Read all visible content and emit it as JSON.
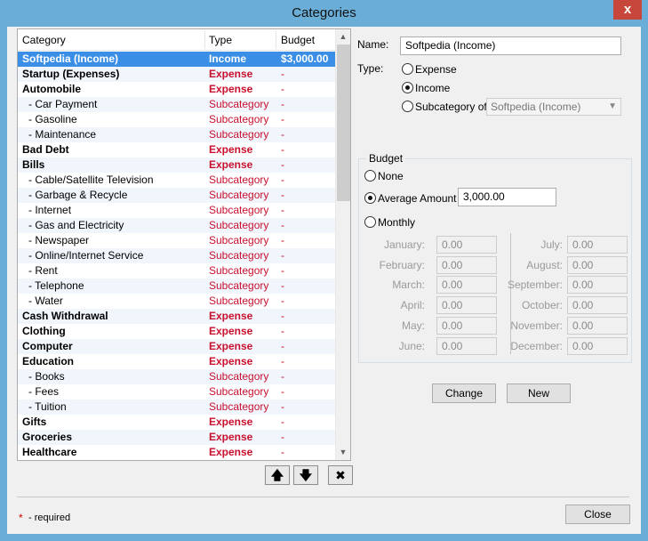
{
  "window": {
    "title": "Categories",
    "close_glyph": "x"
  },
  "list": {
    "headers": {
      "category": "Category",
      "type": "Type",
      "budget": "Budget"
    },
    "rows": [
      {
        "name": "Softpedia (Income)",
        "type": "Income",
        "budget": "$3,000.00",
        "level": 0,
        "kind": "inc",
        "selected": true
      },
      {
        "name": "Startup (Expenses)",
        "type": "Expense",
        "budget": "-",
        "level": 0,
        "kind": "exp"
      },
      {
        "name": "Automobile",
        "type": "Expense",
        "budget": "-",
        "level": 0,
        "kind": "exp"
      },
      {
        "name": "- Car Payment",
        "type": "Subcategory",
        "budget": "-",
        "level": 1,
        "kind": "sub"
      },
      {
        "name": "- Gasoline",
        "type": "Subcategory",
        "budget": "-",
        "level": 1,
        "kind": "sub"
      },
      {
        "name": "- Maintenance",
        "type": "Subcategory",
        "budget": "-",
        "level": 1,
        "kind": "sub"
      },
      {
        "name": "Bad Debt",
        "type": "Expense",
        "budget": "-",
        "level": 0,
        "kind": "exp"
      },
      {
        "name": "Bills",
        "type": "Expense",
        "budget": "-",
        "level": 0,
        "kind": "exp"
      },
      {
        "name": "- Cable/Satellite Television",
        "type": "Subcategory",
        "budget": "-",
        "level": 1,
        "kind": "sub"
      },
      {
        "name": "- Garbage & Recycle",
        "type": "Subcategory",
        "budget": "-",
        "level": 1,
        "kind": "sub"
      },
      {
        "name": "- Internet",
        "type": "Subcategory",
        "budget": "-",
        "level": 1,
        "kind": "sub"
      },
      {
        "name": "- Gas and Electricity",
        "type": "Subcategory",
        "budget": "-",
        "level": 1,
        "kind": "sub"
      },
      {
        "name": "- Newspaper",
        "type": "Subcategory",
        "budget": "-",
        "level": 1,
        "kind": "sub"
      },
      {
        "name": "- Online/Internet Service",
        "type": "Subcategory",
        "budget": "-",
        "level": 1,
        "kind": "sub"
      },
      {
        "name": "- Rent",
        "type": "Subcategory",
        "budget": "-",
        "level": 1,
        "kind": "sub"
      },
      {
        "name": "- Telephone",
        "type": "Subcategory",
        "budget": "-",
        "level": 1,
        "kind": "sub"
      },
      {
        "name": "- Water",
        "type": "Subcategory",
        "budget": "-",
        "level": 1,
        "kind": "sub"
      },
      {
        "name": "Cash Withdrawal",
        "type": "Expense",
        "budget": "-",
        "level": 0,
        "kind": "exp"
      },
      {
        "name": "Clothing",
        "type": "Expense",
        "budget": "-",
        "level": 0,
        "kind": "exp"
      },
      {
        "name": "Computer",
        "type": "Expense",
        "budget": "-",
        "level": 0,
        "kind": "exp"
      },
      {
        "name": "Education",
        "type": "Expense",
        "budget": "-",
        "level": 0,
        "kind": "exp"
      },
      {
        "name": "- Books",
        "type": "Subcategory",
        "budget": "-",
        "level": 1,
        "kind": "sub"
      },
      {
        "name": "- Fees",
        "type": "Subcategory",
        "budget": "-",
        "level": 1,
        "kind": "sub"
      },
      {
        "name": "- Tuition",
        "type": "Subcategory",
        "budget": "-",
        "level": 1,
        "kind": "sub"
      },
      {
        "name": "Gifts",
        "type": "Expense",
        "budget": "-",
        "level": 0,
        "kind": "exp"
      },
      {
        "name": "Groceries",
        "type": "Expense",
        "budget": "-",
        "level": 0,
        "kind": "exp"
      },
      {
        "name": "Healthcare",
        "type": "Expense",
        "budget": "-",
        "level": 0,
        "kind": "exp"
      }
    ]
  },
  "list_buttons": {
    "up": "🡅",
    "down": "🡇",
    "delete": "✖"
  },
  "form": {
    "name_label": "Name:",
    "name_value": "Softpedia (Income)",
    "type_label": "Type:",
    "type_expense": "Expense",
    "type_income": "Income",
    "type_subcategory_of": "Subcategory of",
    "subcategory_value": "Softpedia (Income)",
    "selected_type": "income"
  },
  "budget": {
    "group_title": "Budget",
    "none": "None",
    "average": "Average Amount",
    "average_value": "3,000.00",
    "monthly": "Monthly",
    "selected": "average",
    "months_left": [
      {
        "label": "January:",
        "value": "0.00"
      },
      {
        "label": "February:",
        "value": "0.00"
      },
      {
        "label": "March:",
        "value": "0.00"
      },
      {
        "label": "April:",
        "value": "0.00"
      },
      {
        "label": "May:",
        "value": "0.00"
      },
      {
        "label": "June:",
        "value": "0.00"
      }
    ],
    "months_right": [
      {
        "label": "July:",
        "value": "0.00"
      },
      {
        "label": "August:",
        "value": "0.00"
      },
      {
        "label": "September:",
        "value": "0.00"
      },
      {
        "label": "October:",
        "value": "0.00"
      },
      {
        "label": "November:",
        "value": "0.00"
      },
      {
        "label": "December:",
        "value": "0.00"
      }
    ]
  },
  "actions": {
    "change": "Change",
    "new": "New",
    "close": "Close"
  },
  "footer": {
    "star": "*",
    "required_text": "- required"
  }
}
